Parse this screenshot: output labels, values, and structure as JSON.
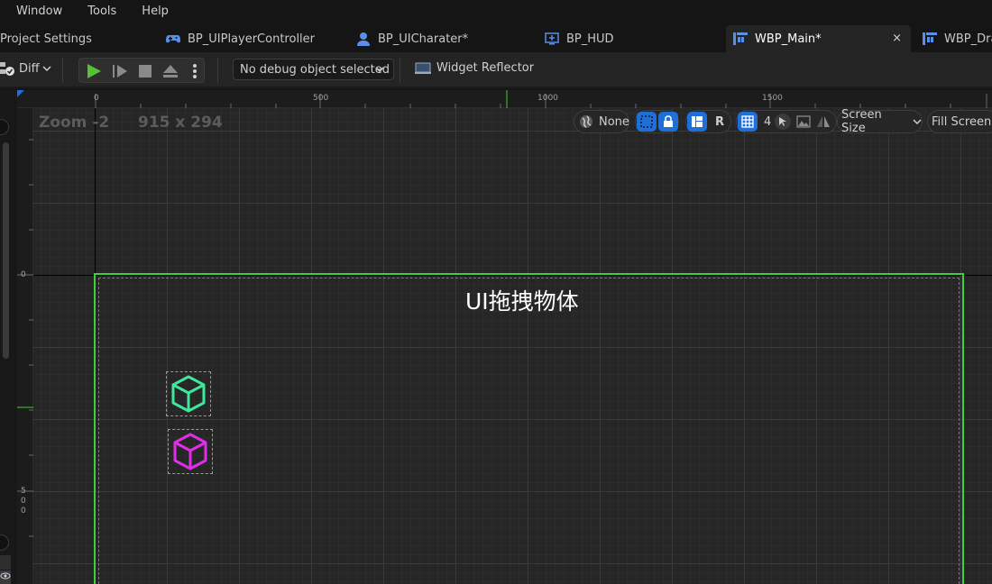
{
  "menu": [
    "Window",
    "Tools",
    "Help"
  ],
  "tabs": [
    {
      "label": "Project Settings",
      "icon": "settings-icon"
    },
    {
      "label": "BP_UIPlayerController",
      "icon": "gamepad-icon"
    },
    {
      "label": "BP_UICharater*",
      "icon": "character-icon"
    },
    {
      "label": "BP_HUD",
      "icon": "hud-icon"
    },
    {
      "label": "WBP_Main*",
      "icon": "widget-blueprint-icon",
      "active": true
    },
    {
      "label": "WBP_Dra",
      "icon": "widget-blueprint-icon"
    }
  ],
  "tab_close": "×",
  "toolbar": {
    "diff_label": "Diff",
    "debug_select": "No debug object selected",
    "widget_reflector": "Widget Reflector"
  },
  "viewport": {
    "zoom": "Zoom -2",
    "dimensions": "915 x 294",
    "none_label": "None",
    "r_label": "R",
    "grid_count": "4",
    "screen_size": "Screen Size",
    "fill_screen": "Fill Screen",
    "title_text": "UI拖拽物体"
  },
  "ruler_top": [
    "0",
    "500",
    "1000",
    "1500"
  ],
  "ruler_left": [
    "0",
    "5",
    "0",
    "0"
  ],
  "colors": {
    "accent_green": "#3ad13a",
    "cube_green": "#3de89c",
    "cube_magenta": "#e02ee8",
    "blue": "#1f6fd8"
  }
}
